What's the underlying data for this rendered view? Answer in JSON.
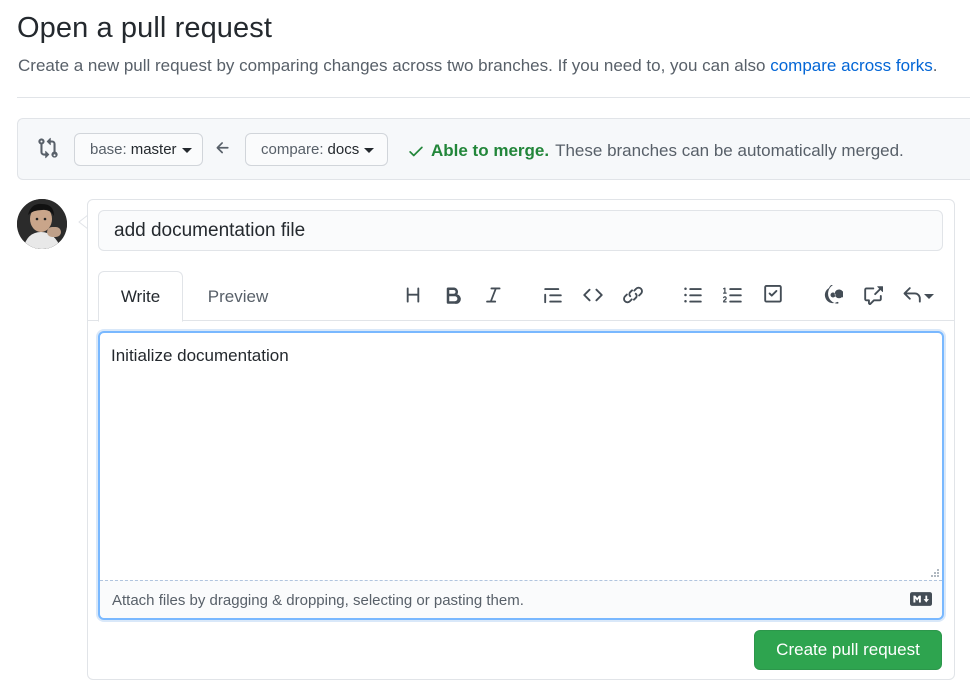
{
  "header": {
    "title": "Open a pull request",
    "subtitle_prefix": "Create a new pull request by comparing changes across two branches. If you need to, you can also ",
    "subtitle_link": "compare across forks",
    "subtitle_suffix": "."
  },
  "range": {
    "base_label": "base:",
    "base_branch": "master",
    "compare_label": "compare:",
    "compare_branch": "docs",
    "merge_ok": "Able to merge.",
    "merge_detail": "These branches can be automatically merged."
  },
  "form": {
    "title_value": "add documentation file",
    "tabs": [
      {
        "label": "Write",
        "active": true
      },
      {
        "label": "Preview",
        "active": false
      }
    ],
    "toolbar": [
      "heading-icon",
      "bold-icon",
      "italic-icon",
      "quote-icon",
      "code-icon",
      "link-icon",
      "bullet-list-icon",
      "numbered-list-icon",
      "task-list-icon",
      "mention-icon",
      "cross-reference-icon",
      "reply-icon"
    ],
    "body_value": "Initialize documentation",
    "attach_hint": "Attach files by dragging & dropping, selecting or pasting them.",
    "submit_label": "Create pull request"
  },
  "colors": {
    "accent": "#0366d6",
    "success": "#22863a",
    "button_green": "#2ea44f"
  }
}
